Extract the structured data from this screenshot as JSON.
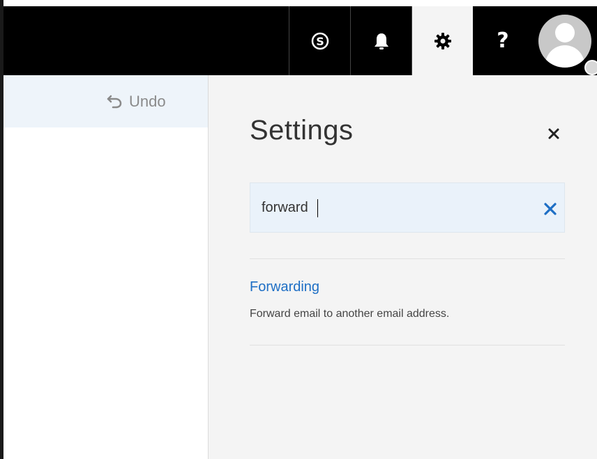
{
  "topbar": {
    "items": [
      {
        "icon": "skype-icon"
      },
      {
        "icon": "bell-icon"
      },
      {
        "icon": "gear-icon",
        "active": true
      },
      {
        "icon": "help-icon",
        "label": "?"
      },
      {
        "icon": "avatar"
      }
    ]
  },
  "undo": {
    "label": "Undo"
  },
  "settings": {
    "title": "Settings",
    "search": {
      "value": "forward"
    },
    "results": [
      {
        "title": "Forwarding",
        "description": "Forward email to another email address."
      }
    ]
  },
  "colors": {
    "topbar_bg": "#000000",
    "active_tab_bg": "#f4f4f4",
    "panel_bg": "#f4f4f4",
    "link": "#1e6fc5",
    "clear_x": "#1e6fc5"
  }
}
